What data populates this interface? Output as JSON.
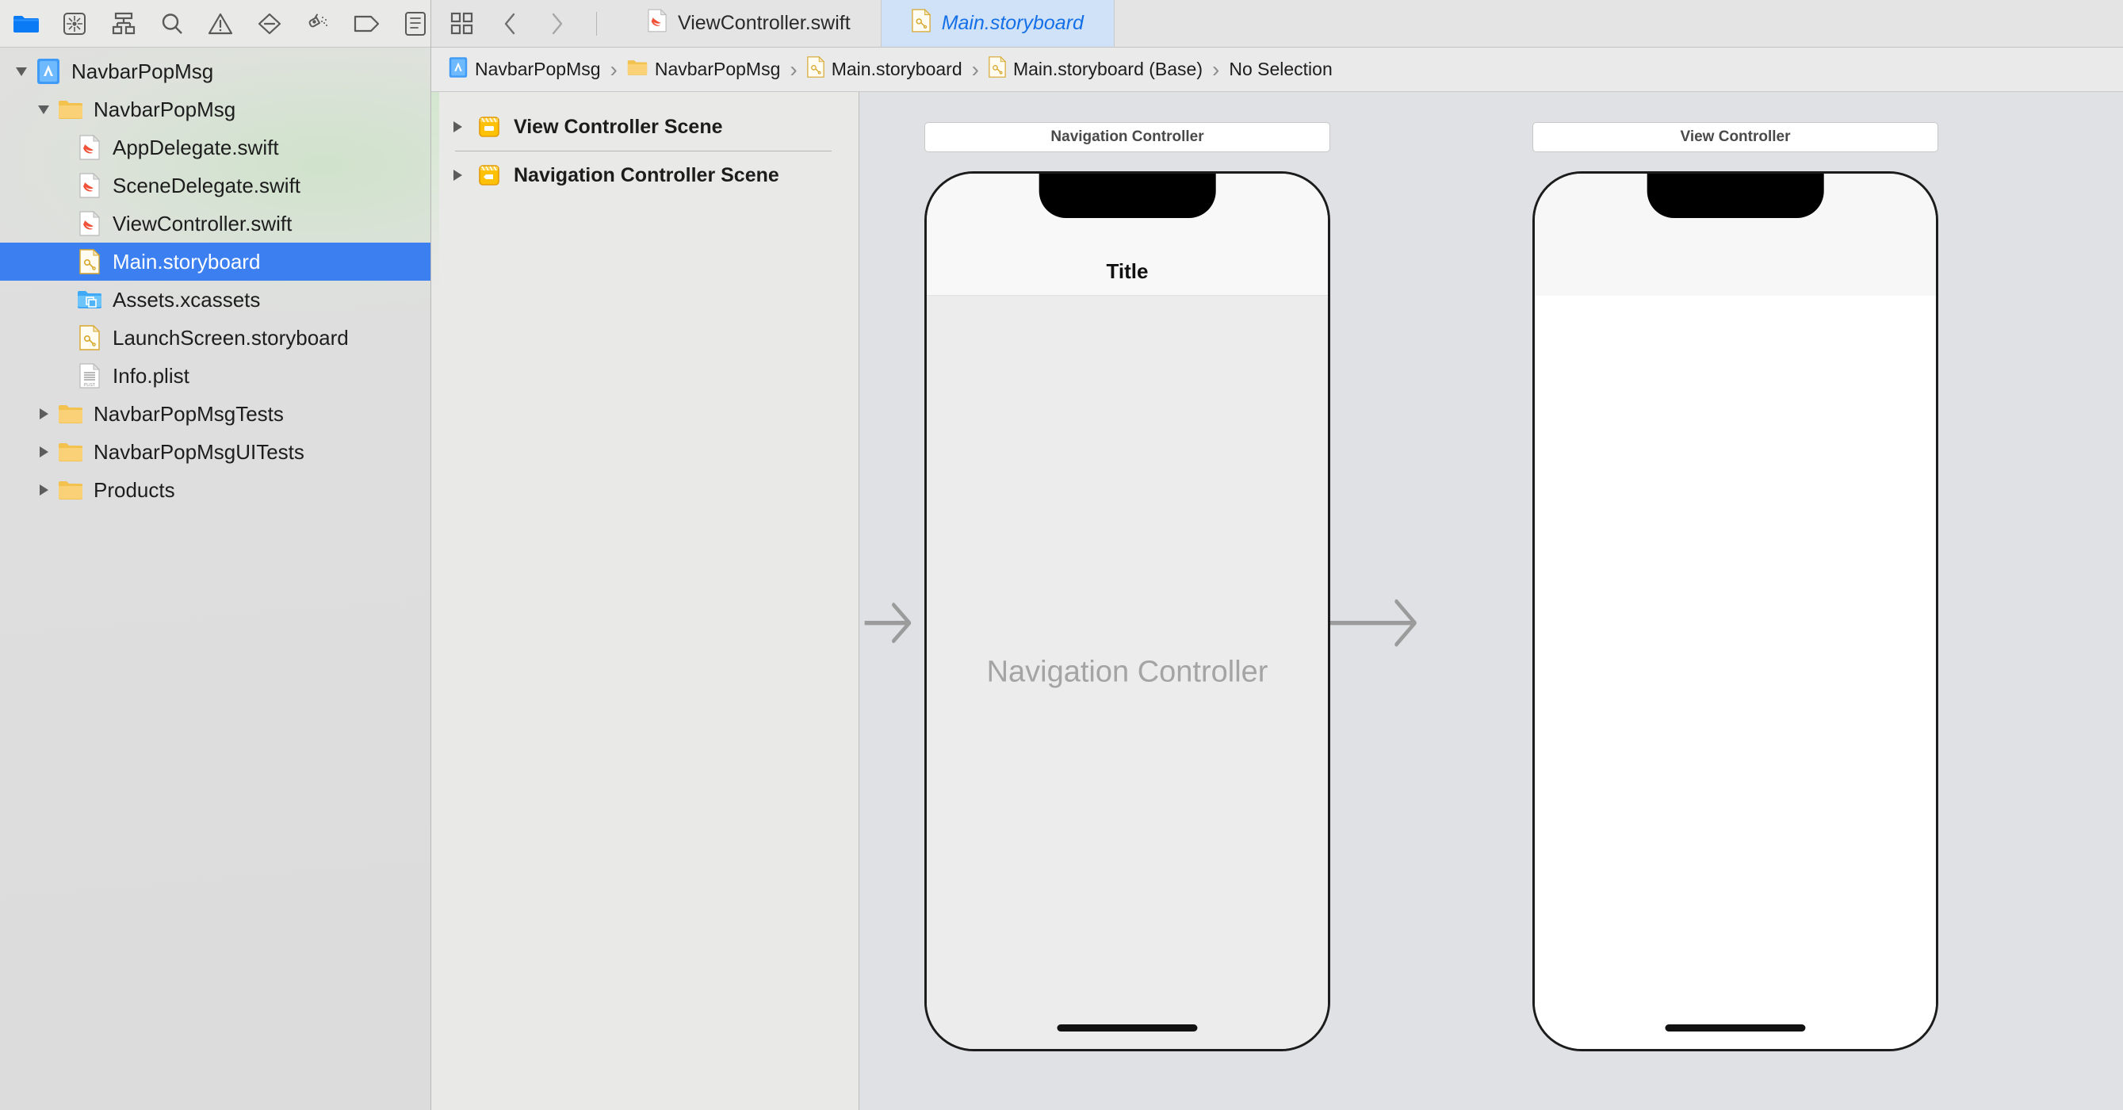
{
  "navigator": {
    "toolbar_icons": [
      {
        "name": "folder-icon",
        "title": "Project navigator",
        "active": true
      },
      {
        "name": "source-control-icon",
        "title": "Source control navigator",
        "active": false
      },
      {
        "name": "symbol-hierarchy-icon",
        "title": "Symbol navigator",
        "active": false
      },
      {
        "name": "search-icon",
        "title": "Find navigator",
        "active": false
      },
      {
        "name": "warning-triangle-icon",
        "title": "Issue navigator",
        "active": false
      },
      {
        "name": "test-diamond-icon",
        "title": "Test navigator",
        "active": false
      },
      {
        "name": "debug-spray-icon",
        "title": "Debug navigator",
        "active": false
      },
      {
        "name": "breakpoint-tag-icon",
        "title": "Breakpoint navigator",
        "active": false
      },
      {
        "name": "report-list-icon",
        "title": "Report navigator",
        "active": false
      }
    ],
    "items": [
      {
        "label": "NavbarPopMsg",
        "icon": "xcode-project-icon",
        "indent": 0,
        "twisty": "open",
        "selected": false
      },
      {
        "label": "NavbarPopMsg",
        "icon": "folder-icon",
        "indent": 1,
        "twisty": "open",
        "selected": false
      },
      {
        "label": "AppDelegate.swift",
        "icon": "swift-file-icon",
        "indent": 2,
        "twisty": "none",
        "selected": false
      },
      {
        "label": "SceneDelegate.swift",
        "icon": "swift-file-icon",
        "indent": 2,
        "twisty": "none",
        "selected": false
      },
      {
        "label": "ViewController.swift",
        "icon": "swift-file-icon",
        "indent": 2,
        "twisty": "none",
        "selected": false
      },
      {
        "label": "Main.storyboard",
        "icon": "storyboard-file-icon",
        "indent": 2,
        "twisty": "none",
        "selected": true
      },
      {
        "label": "Assets.xcassets",
        "icon": "assets-folder-icon",
        "indent": 2,
        "twisty": "none",
        "selected": false
      },
      {
        "label": "LaunchScreen.storyboard",
        "icon": "storyboard-file-icon",
        "indent": 2,
        "twisty": "none",
        "selected": false
      },
      {
        "label": "Info.plist",
        "icon": "plist-file-icon",
        "indent": 2,
        "twisty": "none",
        "selected": false
      },
      {
        "label": "NavbarPopMsgTests",
        "icon": "folder-icon",
        "indent": 1,
        "twisty": "closed",
        "selected": false
      },
      {
        "label": "NavbarPopMsgUITests",
        "icon": "folder-icon",
        "indent": 1,
        "twisty": "closed",
        "selected": false
      },
      {
        "label": "Products",
        "icon": "folder-icon",
        "indent": 1,
        "twisty": "closed",
        "selected": false
      }
    ]
  },
  "editor": {
    "tab_toolbar": {
      "grid_icon": "multi-editor-grid-icon",
      "back_icon": "chevron-left-icon",
      "forward_icon": "chevron-right-icon"
    },
    "tabs": [
      {
        "label": "ViewController.swift",
        "icon": "swift-file-icon",
        "active": false
      },
      {
        "label": "Main.storyboard",
        "icon": "storyboard-file-icon",
        "active": true
      }
    ],
    "breadcrumbs": [
      {
        "label": "NavbarPopMsg",
        "icon": "xcode-project-icon"
      },
      {
        "label": "NavbarPopMsg",
        "icon": "folder-icon"
      },
      {
        "label": "Main.storyboard",
        "icon": "storyboard-file-icon"
      },
      {
        "label": "Main.storyboard (Base)",
        "icon": "storyboard-file-icon"
      },
      {
        "label": "No Selection",
        "icon": "none"
      }
    ],
    "breadcrumb_separator": "›"
  },
  "outline": {
    "items": [
      {
        "label": "View Controller Scene",
        "icon": "view-controller-scene-icon",
        "twisty": "closed"
      },
      {
        "label": "Navigation Controller Scene",
        "icon": "navigation-controller-scene-icon",
        "twisty": "closed"
      }
    ]
  },
  "canvas": {
    "scenes": [
      {
        "id": "navigation-controller-scene",
        "label": "Navigation Controller",
        "navbar_title": "Title",
        "body_text": "Navigation Controller",
        "body_style": "gray"
      },
      {
        "id": "view-controller-scene",
        "label": "View Controller",
        "navbar_title": "",
        "body_text": "",
        "body_style": "white"
      }
    ],
    "connections": [
      {
        "name": "storyboard-entry-point-arrow",
        "kind": "entry-point"
      },
      {
        "name": "relationship-segue-arrow",
        "kind": "relationship-segue",
        "badge_icon": "relationship-segue-icon"
      }
    ]
  },
  "colors": {
    "selection_blue": "#3b7ff0",
    "tab_active_bg": "#cfe2f7",
    "tab_active_text": "#1570e8",
    "canvas_bg": "#dfe1e5",
    "chrome_bg": "#e9e9e7",
    "swift_orange": "#F05138",
    "storyboard_yellow": "#E8A90C"
  }
}
